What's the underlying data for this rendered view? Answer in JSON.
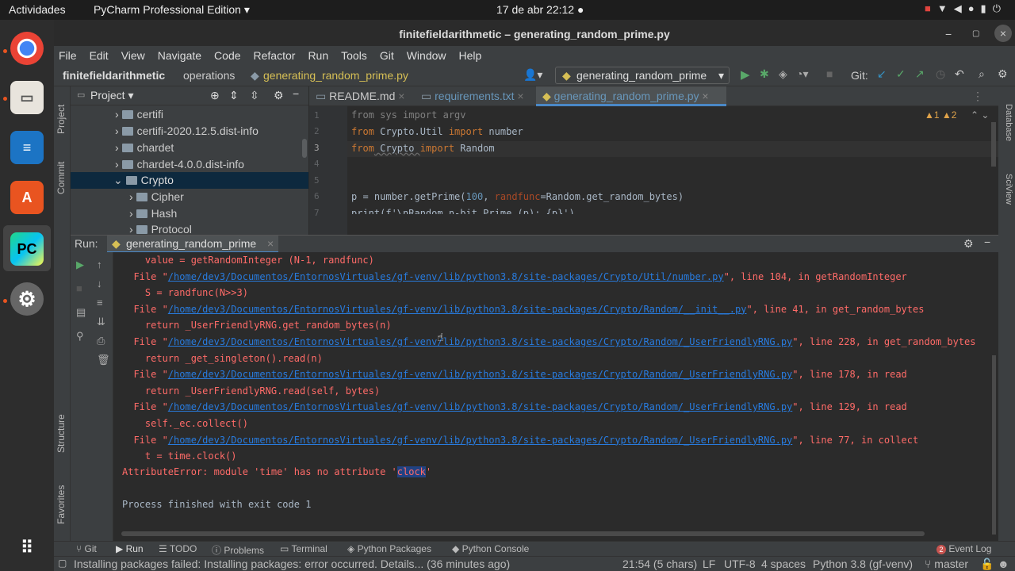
{
  "topbar": {
    "activities": "Actividades",
    "app_menu": "PyCharm Professional Edition ▾",
    "clock": "17 de abr  22:12  ●"
  },
  "window": {
    "title": "finitefieldarithmetic – generating_random_prime.py"
  },
  "menu": [
    "File",
    "Edit",
    "View",
    "Navigate",
    "Code",
    "Refactor",
    "Run",
    "Tools",
    "Git",
    "Window",
    "Help"
  ],
  "navbar": {
    "project": "finitefieldarithmetic",
    "folder": "operations",
    "file": "generating_random_prime.py",
    "run_config": "generating_random_prime",
    "git_label": "Git:"
  },
  "project_panel": {
    "title": "Project ▾",
    "items": [
      {
        "label": "certifi",
        "expanded": false
      },
      {
        "label": "certifi-2020.12.5.dist-info",
        "expanded": false
      },
      {
        "label": "chardet",
        "expanded": false
      },
      {
        "label": "chardet-4.0.0.dist-info",
        "expanded": false
      },
      {
        "label": "Crypto",
        "expanded": true
      },
      {
        "label": "Cipher",
        "expanded": false
      },
      {
        "label": "Hash",
        "expanded": false
      },
      {
        "label": "Protocol",
        "expanded": false
      }
    ]
  },
  "tool_strips": {
    "left_top": "Project",
    "left_commit": "Commit",
    "left_structure": "Structure",
    "left_favorites": "Favorites",
    "right_database": "Database",
    "right_sciview": "SciView"
  },
  "editor": {
    "tabs": [
      {
        "label": "README.md",
        "active": false
      },
      {
        "label": "requirements.txt",
        "active": false
      },
      {
        "label": "generating_random_prime.py",
        "active": true
      }
    ],
    "inspections": "▲1  ▲2",
    "line_numbers": [
      "1",
      "2",
      "3",
      "4",
      "5",
      "6",
      "7"
    ],
    "lines": {
      "l1": "from sys import argv",
      "l2_from": "from",
      "l2_mod": " Crypto.Util ",
      "l2_import": "import",
      "l2_name": " number",
      "l3_from": "from",
      "l3_mod": " Crypto ",
      "l3_import": "import",
      "l3_name": " Random",
      "l6_a": "p = number.getPrime(",
      "l6_num": "100",
      "l6_b": ", ",
      "l6_param": "randfunc",
      "l6_c": "=Random.get_random_bytes)",
      "l7": "print(f'\\nRandom n-bit Prime (p): {p}')"
    }
  },
  "run_panel": {
    "label": "Run:",
    "tab": "generating_random_prime",
    "console": [
      {
        "type": "text",
        "text": "    value = getRandomInteger (N-1, randfunc)"
      },
      {
        "type": "file",
        "pre": "  File \"",
        "path": "/home/dev3/Documentos/EntornosVirtuales/gf-venv/lib/python3.8/site-packages/Crypto/Util/number.py",
        "post": "\", line 104, in getRandomInteger"
      },
      {
        "type": "text",
        "text": "    S = randfunc(N>>3)"
      },
      {
        "type": "file",
        "pre": "  File \"",
        "path": "/home/dev3/Documentos/EntornosVirtuales/gf-venv/lib/python3.8/site-packages/Crypto/Random/__init__.py",
        "post": "\", line 41, in get_random_bytes"
      },
      {
        "type": "text",
        "text": "    return _UserFriendlyRNG.get_random_bytes(n)"
      },
      {
        "type": "file",
        "pre": "  File \"",
        "path": "/home/dev3/Documentos/EntornosVirtuales/gf-venv/lib/python3.8/site-packages/Crypto/Random/_UserFriendlyRNG.py",
        "post": "\", line 228, in get_random_bytes"
      },
      {
        "type": "text",
        "text": "    return _get_singleton().read(n)"
      },
      {
        "type": "file",
        "pre": "  File \"",
        "path": "/home/dev3/Documentos/EntornosVirtuales/gf-venv/lib/python3.8/site-packages/Crypto/Random/_UserFriendlyRNG.py",
        "post": "\", line 178, in read"
      },
      {
        "type": "text",
        "text": "    return _UserFriendlyRNG.read(self, bytes)"
      },
      {
        "type": "file",
        "pre": "  File \"",
        "path": "/home/dev3/Documentos/EntornosVirtuales/gf-venv/lib/python3.8/site-packages/Crypto/Random/_UserFriendlyRNG.py",
        "post": "\", line 129, in read"
      },
      {
        "type": "text",
        "text": "    self._ec.collect()"
      },
      {
        "type": "file",
        "pre": "  File \"",
        "path": "/home/dev3/Documentos/EntornosVirtuales/gf-venv/lib/python3.8/site-packages/Crypto/Random/_UserFriendlyRNG.py",
        "post": "\", line 77, in collect"
      },
      {
        "type": "text",
        "text": "    t = time.clock()"
      }
    ],
    "error_pre": "AttributeError: module 'time' has no attribute '",
    "error_hl": "clock",
    "error_post": "'",
    "finished": "Process finished with exit code 1"
  },
  "bottom_tools": {
    "git": "Git",
    "run": "Run",
    "todo": "TODO",
    "problems": "Problems",
    "terminal": "Terminal",
    "python_packages": "Python Packages",
    "python_console": "Python Console",
    "event_log_count": "2",
    "event_log": "Event Log"
  },
  "status": {
    "message": "Installing packages failed: Installing packages: error occurred. Details... (36 minutes ago)",
    "position": "21:54 (5 chars)",
    "line_sep": "LF",
    "encoding": "UTF-8",
    "indent": "4 spaces",
    "interpreter": "Python 3.8 (gf-venv)",
    "branch": "master"
  },
  "colors": {
    "accent": "#4a88c7",
    "error": "#ff6b68",
    "link": "#287bde",
    "run_green": "#59a869"
  }
}
